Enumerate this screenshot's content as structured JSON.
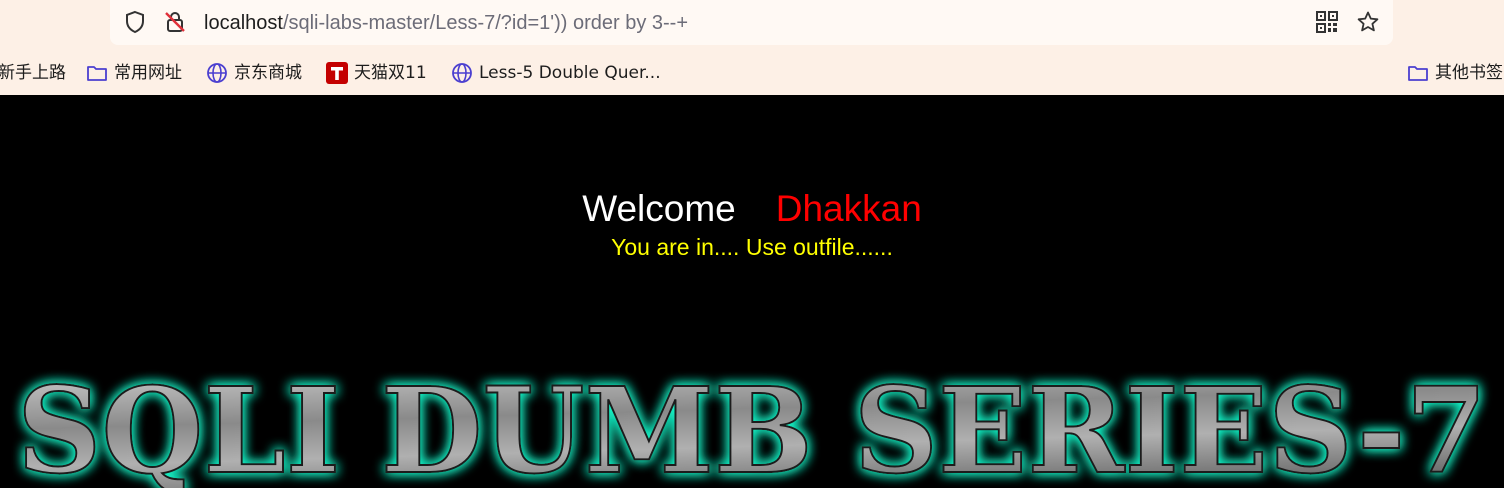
{
  "browser": {
    "url_host": "localhost",
    "url_path": "/sqli-labs-master/Less-7/?id=1')) order by 3--+",
    "icons": {
      "tracking": "shield-icon",
      "security": "insecure-lock-icon",
      "qr": "qr-code-icon",
      "bookmark": "star-icon"
    }
  },
  "bookmarks": {
    "items": [
      {
        "label": "新手上路",
        "icon": "none"
      },
      {
        "label": "常用网址",
        "icon": "folder-icon"
      },
      {
        "label": "京东商城",
        "icon": "globe-icon"
      },
      {
        "label": "天猫双11",
        "icon": "tmall-icon"
      },
      {
        "label": "Less-5 Double Quer...",
        "icon": "globe-icon"
      }
    ],
    "other_label": "其他书签"
  },
  "page": {
    "welcome": "Welcome",
    "name": "Dhakkan",
    "message": "You are in.... Use outfile......",
    "banner_text": "SQLI DUMB SERIES-7",
    "colors": {
      "background": "#000000",
      "welcome": "#ffffff",
      "name": "#ff0000",
      "message": "#ffff00",
      "banner_glow": "#19f5c8",
      "banner_fill": "#9a9a9a"
    }
  }
}
